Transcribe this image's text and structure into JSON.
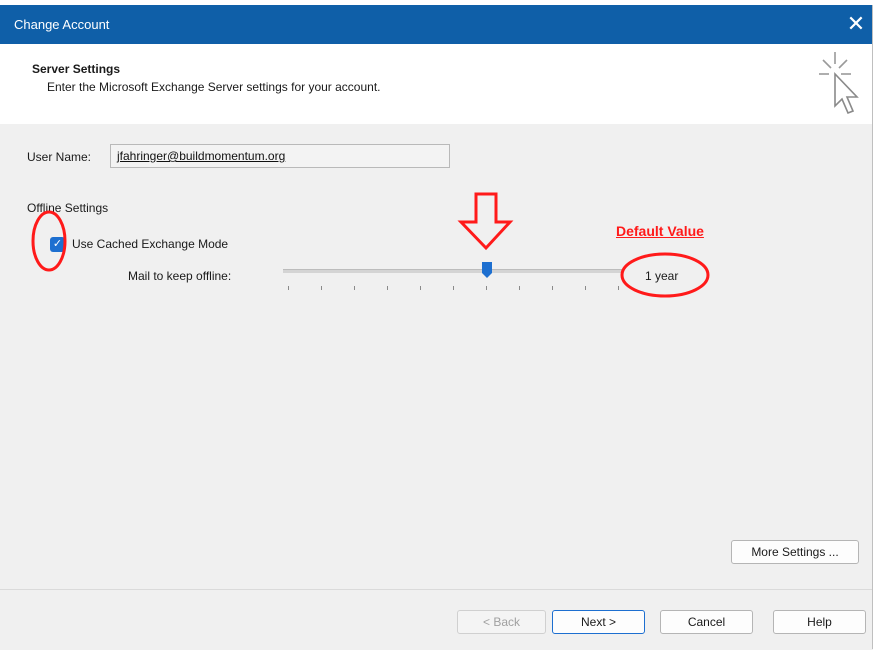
{
  "window": {
    "title": "Change Account",
    "close_glyph": "✕"
  },
  "header": {
    "title": "Server Settings",
    "subtitle": "Enter the Microsoft Exchange Server settings for your account.",
    "icon": "cursor-sparkle-icon"
  },
  "form": {
    "user_name_label": "User Name:",
    "user_name_value": "jfahringer@buildmomentum.org",
    "offline_settings_label": "Offline Settings",
    "cached_mode_label": "Use Cached Exchange Mode",
    "cached_mode_checked": true,
    "mail_offline_label": "Mail to keep offline:",
    "mail_offline_value": "1 year",
    "slider_position_fraction": 0.6
  },
  "annotations": {
    "default_value_label": "Default Value",
    "color": "#ff1a1a"
  },
  "buttons": {
    "more_settings": "More Settings ...",
    "back": "< Back",
    "next": "Next >",
    "cancel": "Cancel",
    "help": "Help"
  },
  "colors": {
    "title_bar": "#0f5fa8",
    "accent": "#1d6fd0"
  }
}
